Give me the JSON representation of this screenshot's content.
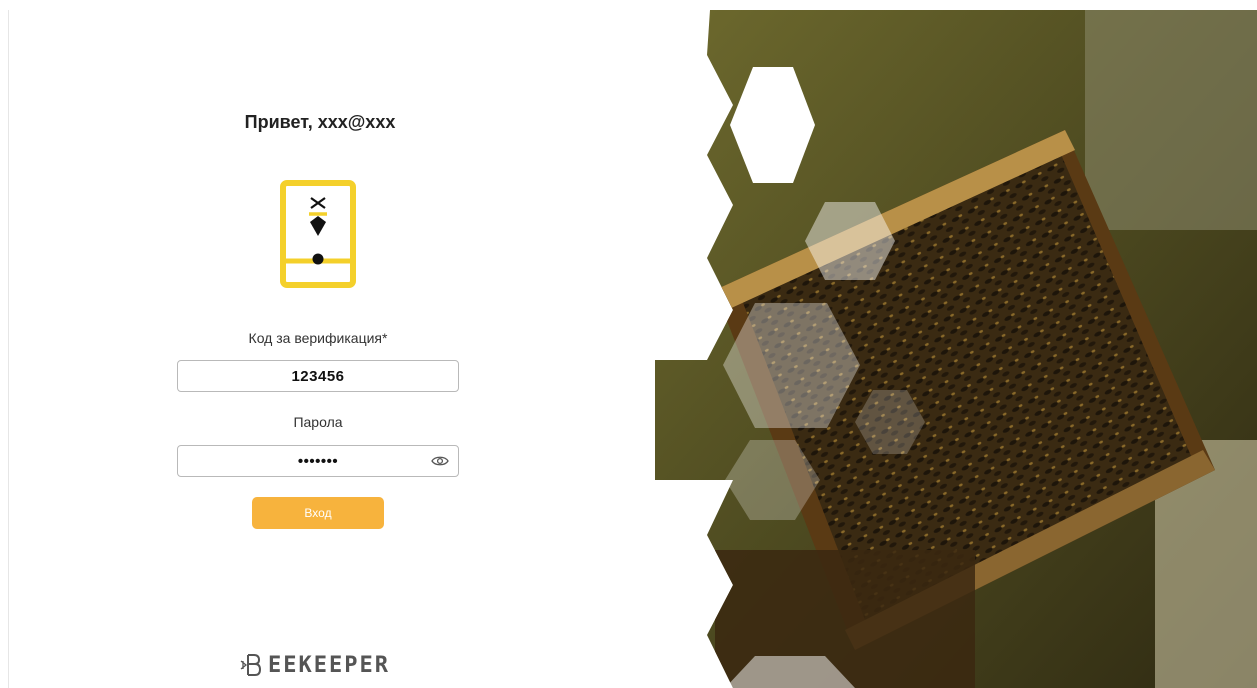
{
  "login": {
    "greeting": "Привет, xxx@xxx",
    "code_label": "Код за верификация*",
    "code_value": "123456",
    "password_label": "Парола",
    "password_value": "•••••••",
    "submit_label": "Вход"
  },
  "brand": {
    "wordmark": "EEKEEPER"
  },
  "icons": {
    "app_logo": "bee-phone-icon",
    "password_toggle": "eye-icon",
    "brand_mark": "bee-b-icon"
  },
  "colors": {
    "accent": "#f7b33d",
    "logo_yellow": "#f4d02b",
    "text_dark": "#222222",
    "input_border": "#b9b9b9"
  }
}
